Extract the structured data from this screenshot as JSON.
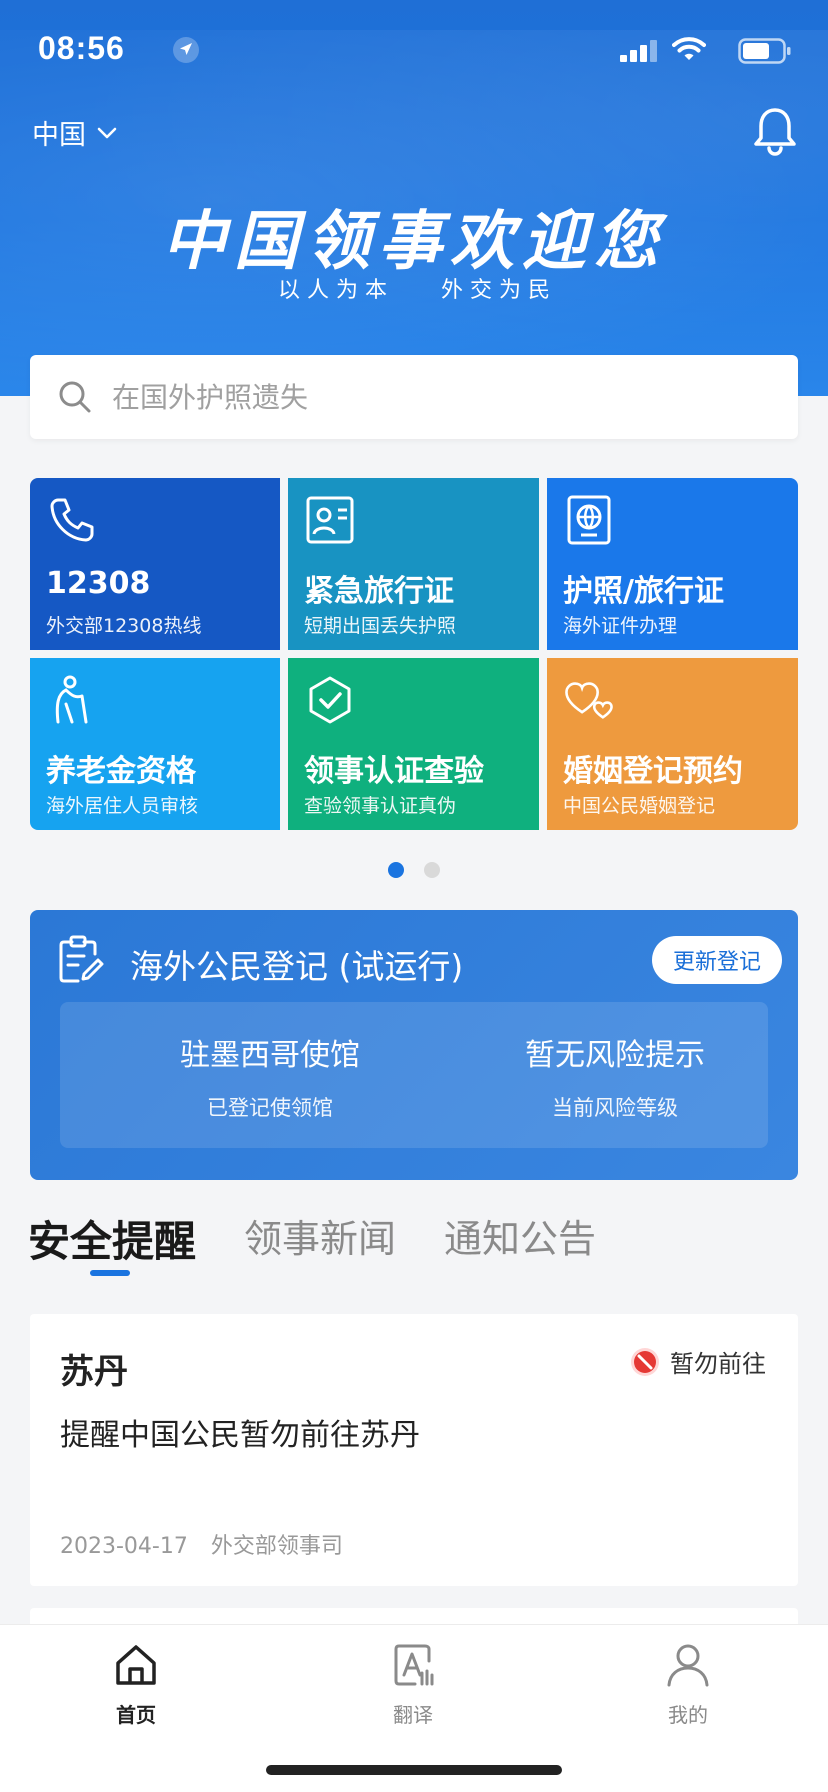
{
  "status_bar": {
    "time": "08:56",
    "icons": [
      "location-arrow-icon",
      "signal-icon",
      "wifi-icon",
      "battery-icon"
    ]
  },
  "header": {
    "region": "中国",
    "slogan": "中国领事欢迎您",
    "sub_slogan_left": "以 人 为 本",
    "sub_slogan_right": "外 交 为 民",
    "bell_icon": "bell-icon"
  },
  "search": {
    "placeholder": "在国外护照遗失"
  },
  "services": [
    {
      "title": "12308",
      "subtitle": "外交部12308热线",
      "icon": "phone-icon",
      "color": "#1558c4"
    },
    {
      "title": "紧急旅行证",
      "subtitle": "短期出国丢失护照",
      "icon": "id-card-icon",
      "color": "#1893c2"
    },
    {
      "title": "护照/旅行证",
      "subtitle": "海外证件办理",
      "icon": "passport-icon",
      "color": "#1a78ea"
    },
    {
      "title": "养老金资格",
      "subtitle": "海外居住人员审核",
      "icon": "elderly-icon",
      "color": "#16a3f0"
    },
    {
      "title": "领事认证查验",
      "subtitle": "查验领事认证真伪",
      "icon": "shield-check-icon",
      "color": "#0fb07e"
    },
    {
      "title": "婚姻登记预约",
      "subtitle": "中国公民婚姻登记",
      "icon": "hearts-icon",
      "color": "#ee9a3e"
    }
  ],
  "pager": {
    "pages": 2,
    "active": 1
  },
  "registration": {
    "title": "海外公民登记 (试运行)",
    "button": "更新登记",
    "embassy_value": "驻墨西哥使馆",
    "embassy_label": "已登记使领馆",
    "risk_value": "暂无风险提示",
    "risk_label": "当前风险等级"
  },
  "tabs": [
    {
      "label": "安全提醒",
      "active": true
    },
    {
      "label": "领事新闻",
      "active": false
    },
    {
      "label": "通知公告",
      "active": false
    }
  ],
  "articles": [
    {
      "country": "苏丹",
      "badge": "暂勿前往",
      "badge_color": "#e53935",
      "text": "提醒中国公民暂勿前往苏丹",
      "date": "2023-04-17",
      "source": "外交部领事司"
    }
  ],
  "bottom_nav": [
    {
      "label": "首页",
      "icon": "home-icon",
      "active": true
    },
    {
      "label": "翻译",
      "icon": "translate-icon",
      "active": false
    },
    {
      "label": "我的",
      "icon": "user-icon",
      "active": false
    }
  ]
}
